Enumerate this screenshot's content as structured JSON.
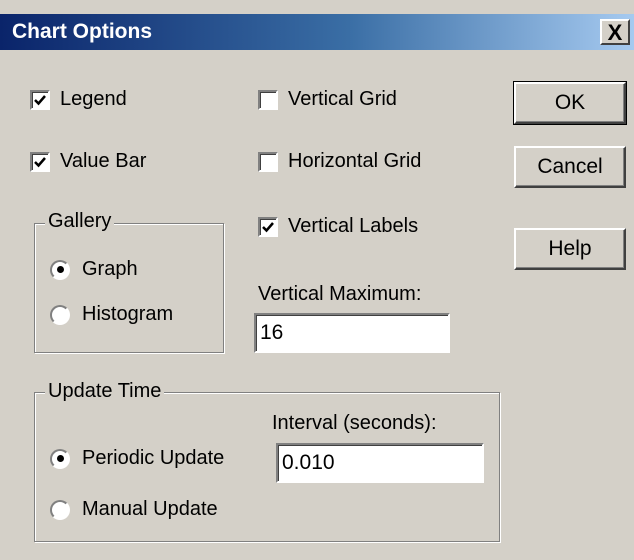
{
  "window": {
    "title": "Chart Options",
    "close_glyph": "X"
  },
  "options": {
    "legend": {
      "label": "Legend",
      "checked": true
    },
    "value_bar": {
      "label": "Value Bar",
      "checked": true
    },
    "vertical_grid": {
      "label": "Vertical Grid",
      "checked": false
    },
    "horizontal_grid": {
      "label": "Horizontal Grid",
      "checked": false
    },
    "vertical_labels": {
      "label": "Vertical Labels",
      "checked": true
    }
  },
  "gallery": {
    "title": "Gallery",
    "graph": {
      "label": "Graph",
      "selected": true
    },
    "histogram": {
      "label": "Histogram",
      "selected": false
    }
  },
  "vertical_maximum": {
    "label": "Vertical Maximum:",
    "value": "16"
  },
  "update_time": {
    "title": "Update Time",
    "interval_label": "Interval (seconds):",
    "interval_value": "0.010",
    "periodic": {
      "label": "Periodic Update",
      "selected": true
    },
    "manual": {
      "label": "Manual Update",
      "selected": false
    }
  },
  "buttons": {
    "ok": "OK",
    "cancel": "Cancel",
    "help": "Help"
  }
}
